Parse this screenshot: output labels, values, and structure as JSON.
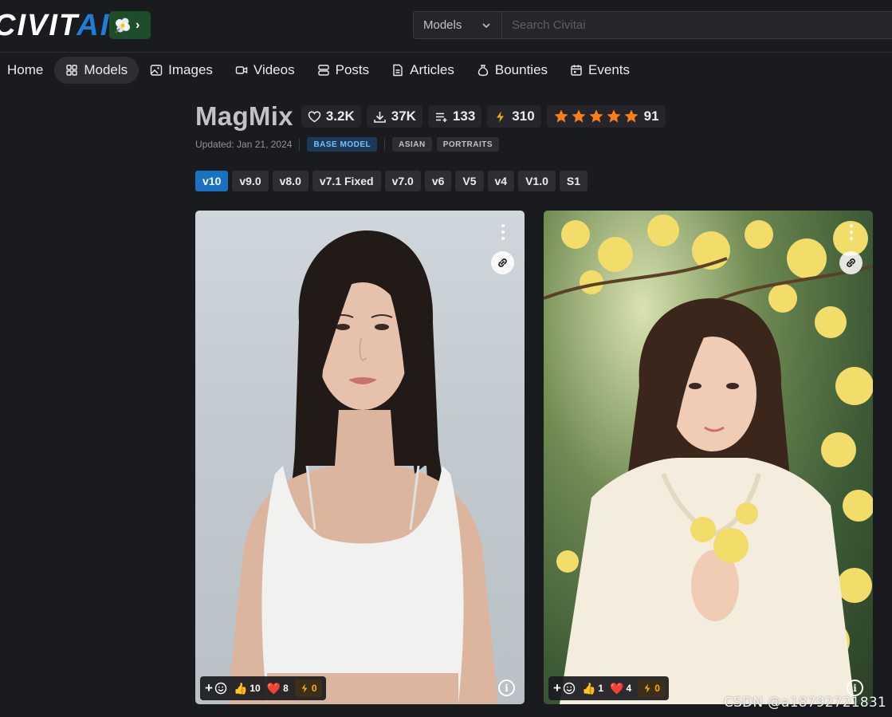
{
  "header": {
    "logo_part1": "CIVIT",
    "logo_part2": "AI",
    "search_type": "Models",
    "search_placeholder": "Search Civitai"
  },
  "nav": [
    {
      "label": "Home",
      "icon": "home-icon"
    },
    {
      "label": "Models",
      "icon": "grid-icon",
      "active": true
    },
    {
      "label": "Images",
      "icon": "image-icon"
    },
    {
      "label": "Videos",
      "icon": "video-icon"
    },
    {
      "label": "Posts",
      "icon": "posts-icon"
    },
    {
      "label": "Articles",
      "icon": "article-icon"
    },
    {
      "label": "Bounties",
      "icon": "bounty-icon"
    },
    {
      "label": "Events",
      "icon": "calendar-icon"
    }
  ],
  "model": {
    "title": "MagMix",
    "likes": "3.2K",
    "downloads": "37K",
    "collections": "133",
    "buzz": "310",
    "rating_count": "91",
    "rating_stars": 5,
    "updated": "Updated: Jan 21, 2024",
    "base_model_chip": "BASE MODEL",
    "tags": [
      "ASIAN",
      "PORTRAITS"
    ]
  },
  "versions": [
    "v10",
    "v9.0",
    "v8.0",
    "v7.1 Fixed",
    "v7.0",
    "v6",
    "V5",
    "v4",
    "V1.0",
    "S1"
  ],
  "cards": [
    {
      "likes": "10",
      "hearts": "8",
      "buzz": "0"
    },
    {
      "likes": "1",
      "hearts": "4",
      "buzz": "0"
    }
  ],
  "watermark": "CSDN @a18792721831",
  "colors": {
    "background": "#1a1b1e",
    "accent": "#1971c2",
    "star": "#fd7e14",
    "buzz": "#fab005"
  }
}
